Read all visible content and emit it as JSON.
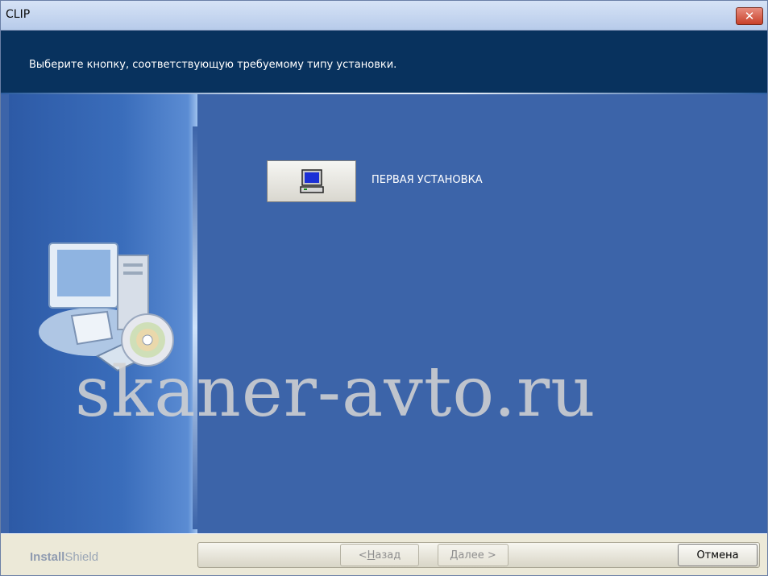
{
  "window": {
    "title": "CLIP"
  },
  "header": {
    "instruction": "Выберите кнопку, соответствующую требуемому типу установки."
  },
  "main": {
    "install_option_label": "ПЕРВАЯ УСТАНОВКА",
    "watermark": "skaner-avto.ru"
  },
  "footer": {
    "brand_strong": "Install",
    "brand_light": "Shield",
    "back_prefix": "< ",
    "back_underlined": "Н",
    "back_rest": "азад",
    "next_underlined": "Д",
    "next_rest": "алее >",
    "cancel_label": "Отмена"
  },
  "icons": {
    "close": "close-icon",
    "install": "computer-icon",
    "art": "computer-cd-art-icon"
  },
  "colors": {
    "header_bg": "#08325e",
    "content_bg": "#3c64a9",
    "footer_bg": "#ece9d8"
  }
}
